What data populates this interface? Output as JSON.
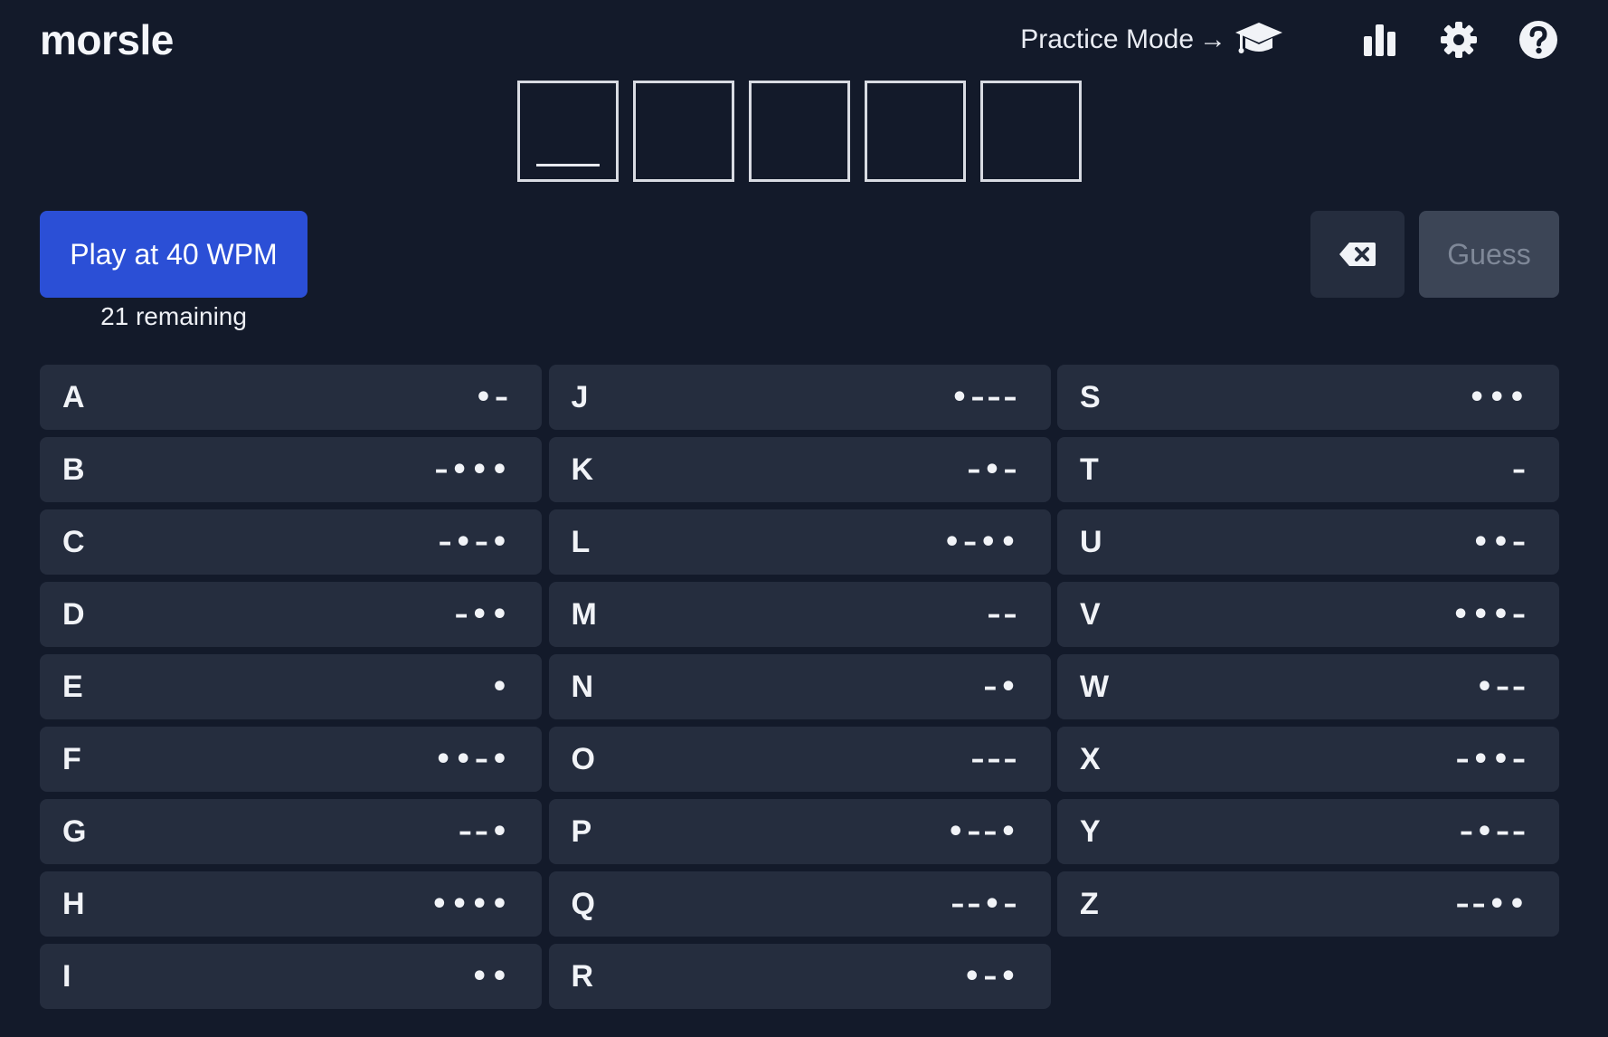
{
  "header": {
    "logo": "morsle",
    "practice_label": "Practice Mode",
    "practice_arrow": "→",
    "icons": [
      "graduation-cap-icon",
      "stats-icon",
      "settings-icon",
      "help-icon"
    ]
  },
  "slots": [
    "",
    "",
    "",
    "",
    ""
  ],
  "controls": {
    "play_label": "Play at 40 WPM",
    "remaining": "21 remaining",
    "guess_label": "Guess"
  },
  "keys": {
    "col1": [
      {
        "letter": "A",
        "code": "•–"
      },
      {
        "letter": "B",
        "code": "–•••"
      },
      {
        "letter": "C",
        "code": "–•–•"
      },
      {
        "letter": "D",
        "code": "–••"
      },
      {
        "letter": "E",
        "code": "•"
      },
      {
        "letter": "F",
        "code": "••–•"
      },
      {
        "letter": "G",
        "code": "––•"
      },
      {
        "letter": "H",
        "code": "••••"
      },
      {
        "letter": "I",
        "code": "••"
      }
    ],
    "col2": [
      {
        "letter": "J",
        "code": "•–––"
      },
      {
        "letter": "K",
        "code": "–•–"
      },
      {
        "letter": "L",
        "code": "•–••"
      },
      {
        "letter": "M",
        "code": "––"
      },
      {
        "letter": "N",
        "code": "–•"
      },
      {
        "letter": "O",
        "code": "–––"
      },
      {
        "letter": "P",
        "code": "•––•"
      },
      {
        "letter": "Q",
        "code": "––•–"
      },
      {
        "letter": "R",
        "code": "•–•"
      }
    ],
    "col3": [
      {
        "letter": "S",
        "code": "•••"
      },
      {
        "letter": "T",
        "code": "–"
      },
      {
        "letter": "U",
        "code": "••–"
      },
      {
        "letter": "V",
        "code": "•••–"
      },
      {
        "letter": "W",
        "code": "•––"
      },
      {
        "letter": "X",
        "code": "–••–"
      },
      {
        "letter": "Y",
        "code": "–•––"
      },
      {
        "letter": "Z",
        "code": "––••"
      }
    ]
  },
  "colors": {
    "background": "#131a2a",
    "key": "#252d3e",
    "play": "#2b4fd6",
    "guess_disabled": "#3c4556"
  }
}
